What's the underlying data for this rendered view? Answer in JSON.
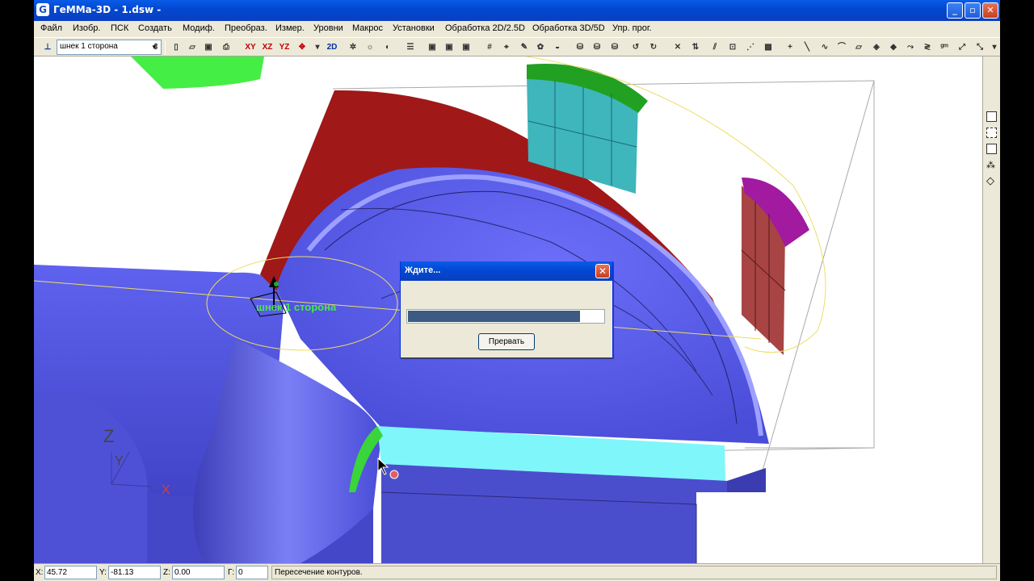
{
  "window": {
    "app_icon": "G",
    "title": "ГеММа-3D - 1.dsw -",
    "controls": {
      "minimize": "_",
      "maximize": "▫",
      "close": "✕"
    }
  },
  "menu": [
    "Файл",
    "Изобр.",
    "ПСК",
    "Создать",
    "Модиф.",
    "Преобраз.",
    "Измер.",
    "Уровни",
    "Макрос",
    "Установки",
    "Обработка 2D/2.5D",
    "Обработка 3D/5D",
    "Упр. прог."
  ],
  "toolbar": {
    "combo_value": "шнек 1 сторона",
    "view_buttons": [
      "XY",
      "XZ",
      "YZ"
    ],
    "mode_2d": "2D"
  },
  "viewport": {
    "model_label": "шнек 1 сторона",
    "axis_labels": {
      "z": "Z",
      "y": "Y",
      "x": "X"
    }
  },
  "dialog": {
    "title": "Ждите...",
    "close": "✕",
    "progress": 0.88,
    "cancel_button": "Прервать"
  },
  "statusbar": {
    "x_label": "X:",
    "x_value": "45.72",
    "y_label": "Y:",
    "y_value": "-81.13",
    "z_label": "Z:",
    "z_value": "0.00",
    "g_label": "Г:",
    "g_value": "0",
    "message": "Пересечение контуров."
  },
  "colors": {
    "surface_blue": "#5a5ef0",
    "surface_red": "#a01818",
    "surface_cyan": "#7ff6fa",
    "surface_green": "#3ad53a",
    "surface_magenta": "#a11aa0",
    "titlebar": "#0248d2"
  }
}
